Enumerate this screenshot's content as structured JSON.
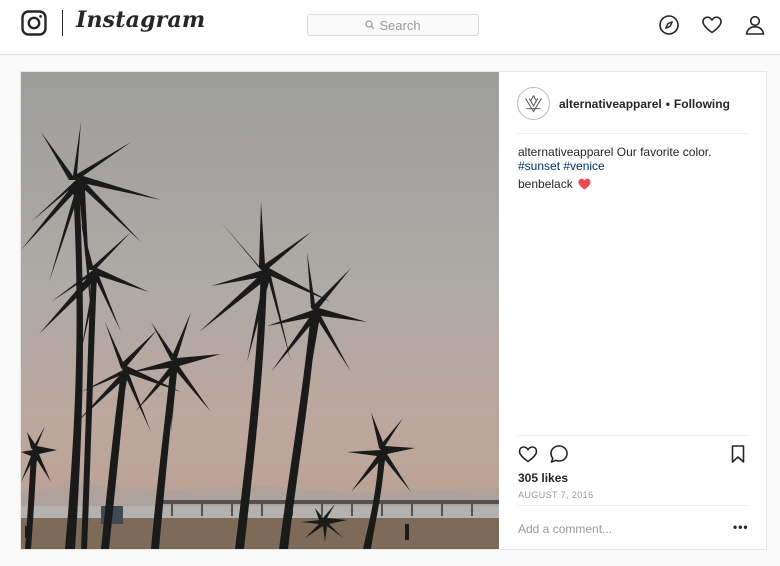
{
  "nav": {
    "brand": "Instagram",
    "search_placeholder": "Search"
  },
  "post": {
    "author": "alternativeapparel",
    "separator": "•",
    "follow_status": "Following",
    "caption": {
      "author": "alternativeapparel",
      "text": "Our favorite color.",
      "hashtags": "#sunset #venice"
    },
    "comments": [
      {
        "user": "benbelack",
        "emoji": "heart"
      }
    ],
    "likes": "305 likes",
    "date": "AUGUST 7, 2016",
    "add_comment_placeholder": "Add a comment...",
    "more_label": "•••"
  },
  "icons": {
    "logo": "instagram-glyph-icon",
    "explore": "compass-icon",
    "activity": "heart-icon",
    "profile": "person-icon",
    "like": "heart-outline-icon",
    "comment": "speech-bubble-icon",
    "save": "bookmark-icon"
  },
  "colors": {
    "link": "#003569",
    "muted": "#999999",
    "border": "#dbdbdb",
    "heart": "#ed4956"
  }
}
